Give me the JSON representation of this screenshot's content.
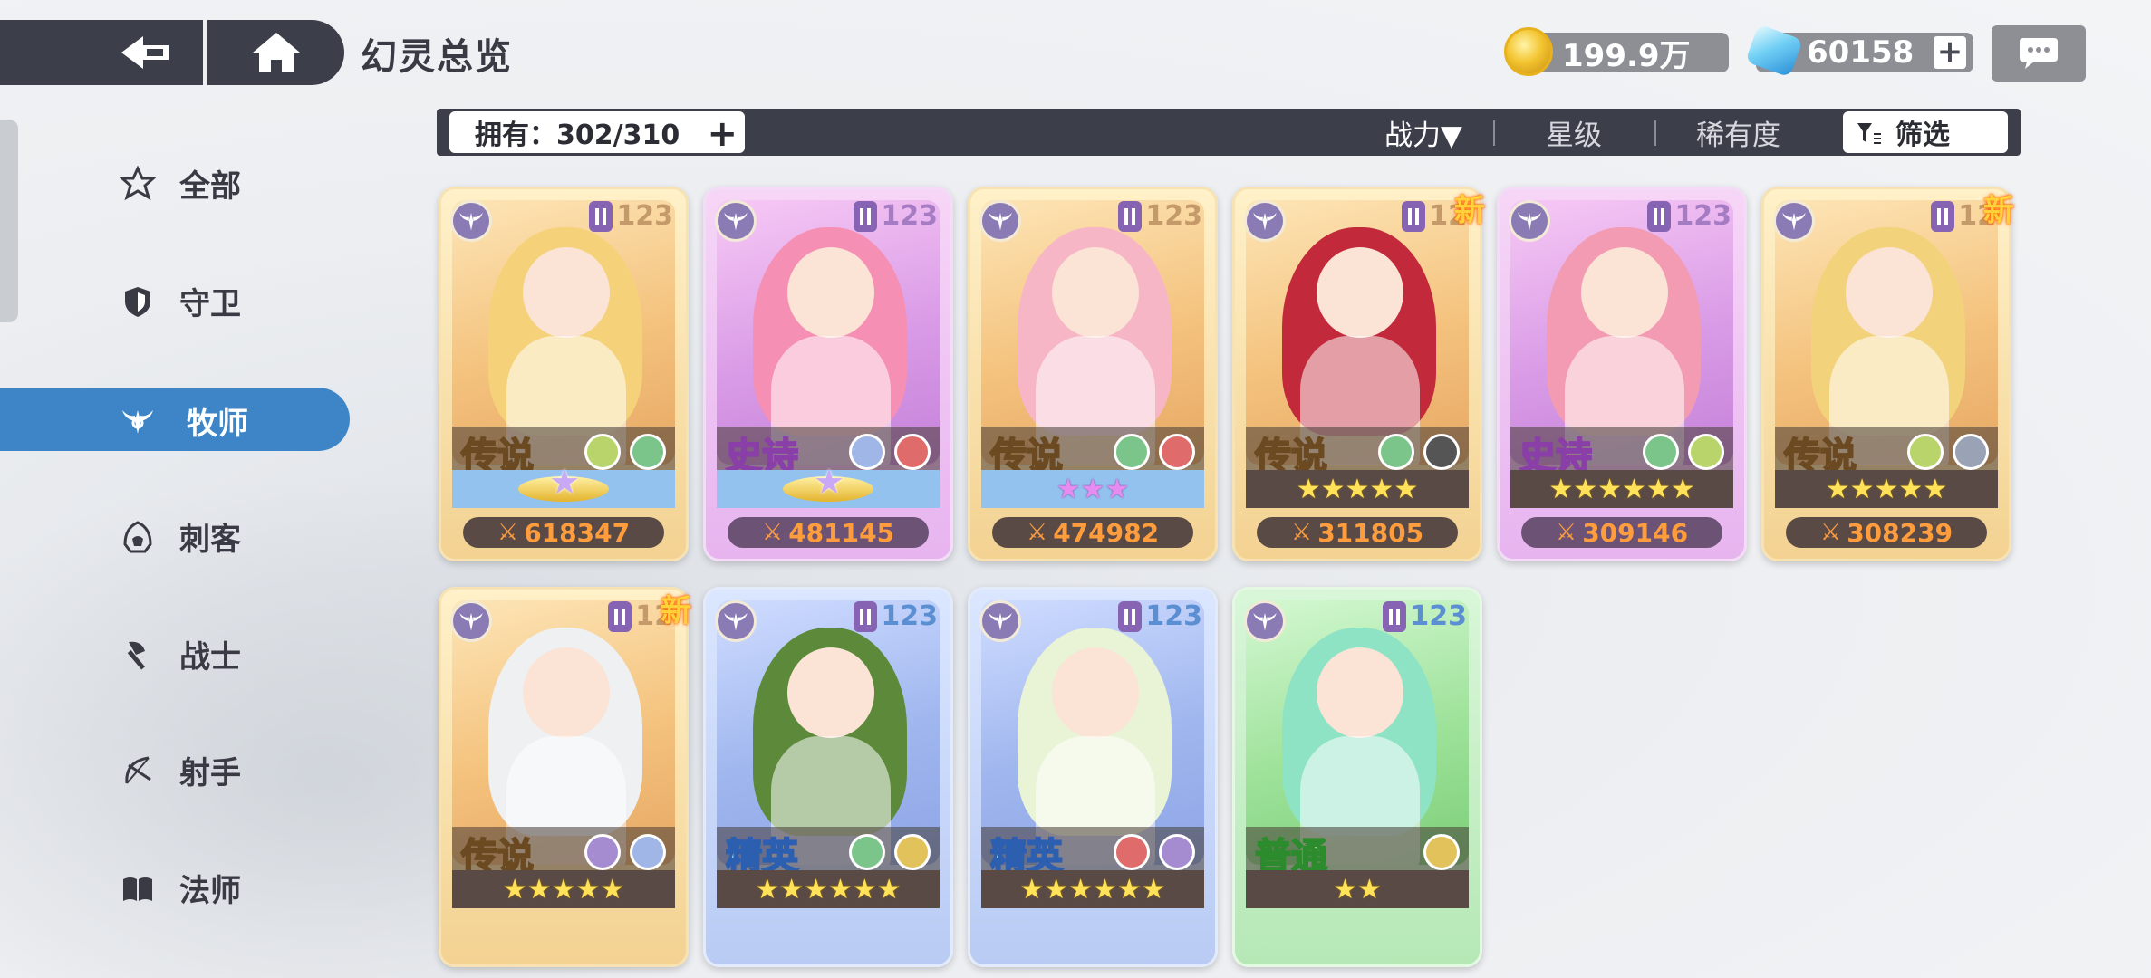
{
  "header": {
    "title": "幻灵总览",
    "gold_value": "199.9万",
    "gem_value": "60158",
    "plus_label": "+"
  },
  "filter_bar": {
    "owned_label": "拥有：302/310",
    "sort_power": "战力▼",
    "sort_star": "星级",
    "sort_rarity": "稀有度",
    "filter_label": "筛选"
  },
  "sidebar": {
    "items": [
      {
        "label": "全部",
        "icon": "hexagram-icon"
      },
      {
        "label": "守卫",
        "icon": "shield-icon"
      },
      {
        "label": "牧师",
        "icon": "priest-wings-icon"
      },
      {
        "label": "刺客",
        "icon": "assassin-hood-icon"
      },
      {
        "label": "战士",
        "icon": "axe-icon"
      },
      {
        "label": "射手",
        "icon": "bow-icon"
      },
      {
        "label": "法师",
        "icon": "book-icon"
      }
    ],
    "active_index": 2
  },
  "cards": [
    {
      "rarity": "传说",
      "level": "123",
      "power": "618347",
      "stars": "crown",
      "new": "",
      "tier": "legend"
    },
    {
      "rarity": "史诗",
      "level": "123",
      "power": "481145",
      "stars": "crown",
      "new": "",
      "tier": "epic"
    },
    {
      "rarity": "传说",
      "level": "123",
      "power": "474982",
      "stars": "★★★",
      "new": "",
      "tier": "legend"
    },
    {
      "rarity": "传说",
      "level": "12",
      "power": "311805",
      "stars": "★★★★★",
      "new": "新",
      "tier": "legend"
    },
    {
      "rarity": "史诗",
      "level": "123",
      "power": "309146",
      "stars": "★★★★★★",
      "new": "",
      "tier": "epic"
    },
    {
      "rarity": "传说",
      "level": "12",
      "power": "308239",
      "stars": "★★★★★",
      "new": "新",
      "tier": "legend"
    },
    {
      "rarity": "传说",
      "level": "12",
      "power": "",
      "stars": "★★★★★",
      "new": "新",
      "tier": "legend"
    },
    {
      "rarity": "精英",
      "level": "123",
      "power": "",
      "stars": "★★★★★★",
      "new": "",
      "tier": "elite"
    },
    {
      "rarity": "精英",
      "level": "123",
      "power": "",
      "stars": "★★★★★★",
      "new": "",
      "tier": "elite"
    },
    {
      "rarity": "普通",
      "level": "123",
      "power": "",
      "stars": "★★",
      "new": "",
      "tier": "common"
    }
  ]
}
